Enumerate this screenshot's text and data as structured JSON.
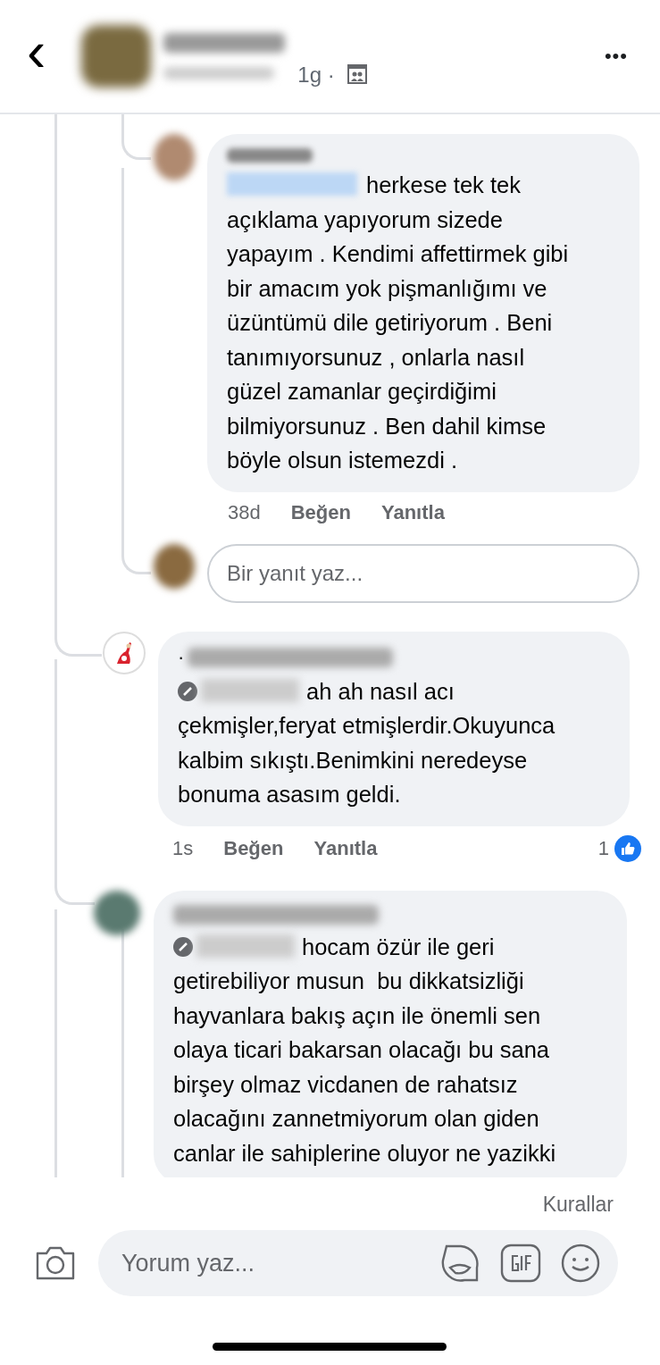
{
  "header": {
    "back": "‹",
    "time": "1g",
    "dot": "·",
    "more": "•••"
  },
  "replies": [
    {
      "text": "herkese tek tek\naçıklama yapıyorum sizede\nyapayım . Kendimi affettirmek gibi\nbir amacım yok pişmanlığımı ve\nüzüntümü dile getiriyorum . Beni\ntanımıyorsunuz , onlarla nasıl\ngüzel zamanlar geçirdiğimi\nbilmiyorsunuz . Ben dahil kimse\nböyle olsun istemezdi .",
      "time": "38d",
      "like": "Beğen",
      "reply": "Yanıtla"
    }
  ],
  "reply_field": {
    "placeholder": "Bir yanıt yaz..."
  },
  "comments": [
    {
      "kind": "flag-avatar",
      "prefix": "·",
      "text": "ah ah nasıl acı\nçekmişler,feryat etmişlerdir.Okuyunca\nkalbim sıkıştı.Benimkini neredeyse\nbonuma asasım geldi.",
      "time": "1s",
      "like": "Beğen",
      "reply": "Yanıtla",
      "likes": "1"
    },
    {
      "kind": "blurred-avatar",
      "text": "hocam özür ile geri\ngetirebiliyor musun  bu dikkatsizliği\nhayvanlara bakış açın ile önemli sen\nolaya ticari bakarsan olacağı bu sana\nbirşey olmaz vicdanen de rahatsız\nolacağını zannetmiyorum olan giden\ncanlar ile sahiplerine oluyor ne yazikki"
    }
  ],
  "footer": {
    "rules": "Kurallar",
    "comment_field": {
      "placeholder": "Yorum yaz..."
    }
  }
}
